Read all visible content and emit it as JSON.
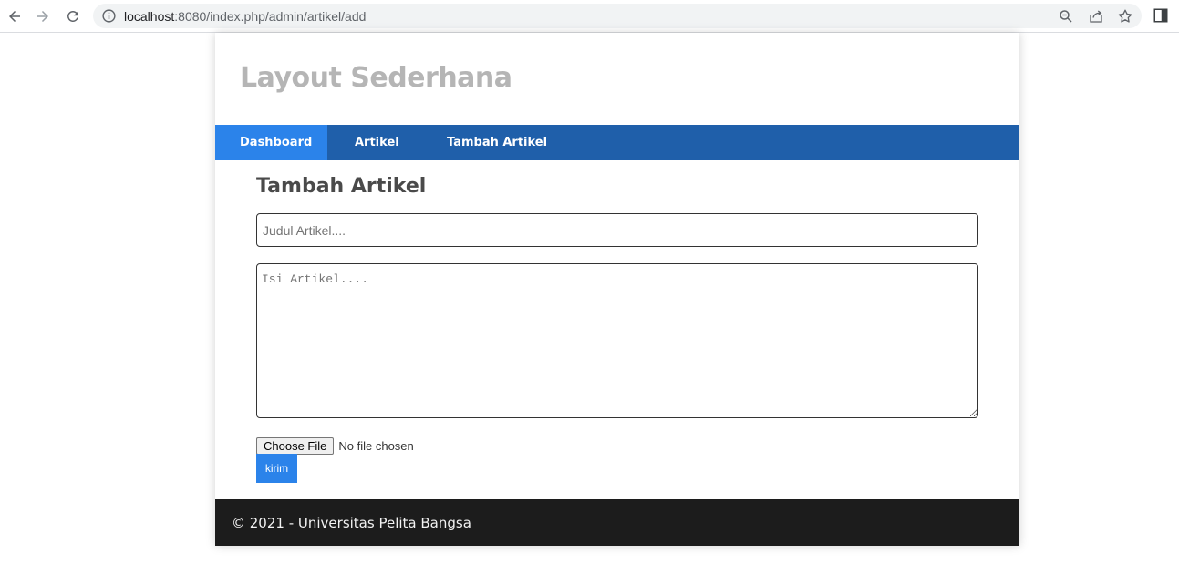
{
  "browser": {
    "url_host": "localhost",
    "url_path": ":8080/index.php/admin/artikel/add",
    "icons": [
      "back-icon",
      "forward-icon",
      "reload-icon",
      "info-icon",
      "zoom-icon",
      "share-icon",
      "bookmark-star-icon",
      "side-panel-icon"
    ]
  },
  "site": {
    "title": "Layout Sederhana"
  },
  "nav": {
    "items": [
      {
        "label": "Dashboard",
        "active": true
      },
      {
        "label": "Artikel",
        "active": false
      },
      {
        "label": "Tambah Artikel",
        "active": false
      }
    ]
  },
  "main": {
    "heading": "Tambah Artikel",
    "title_field": {
      "value": "",
      "placeholder": "Judul Artikel...."
    },
    "body_field": {
      "value": "",
      "placeholder": "Isi Artikel...."
    },
    "file": {
      "button_label": "Choose File",
      "status": "No file chosen"
    },
    "submit_label": "kirim"
  },
  "footer": {
    "text": "© 2021 - Universitas Pelita Bangsa"
  },
  "colors": {
    "nav_bg": "#1f5faa",
    "nav_active": "#2b83ea",
    "submit_bg": "#2b83ea",
    "footer_bg": "#1c1c1c",
    "title_color": "#b5b5b5"
  }
}
